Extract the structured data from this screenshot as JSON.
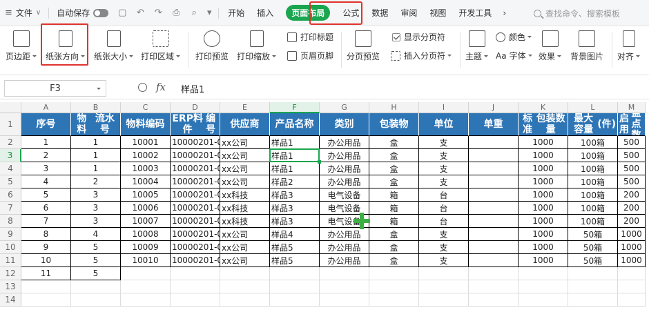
{
  "menubar": {
    "file": "文件",
    "autosave": "自动保存",
    "tabs": [
      {
        "label": "开始",
        "active": false
      },
      {
        "label": "插入",
        "active": false
      },
      {
        "label": "页面布局",
        "active": true
      },
      {
        "label": "公式",
        "active": false
      },
      {
        "label": "数据",
        "active": false
      },
      {
        "label": "审阅",
        "active": false
      },
      {
        "label": "视图",
        "active": false
      },
      {
        "label": "开发工具",
        "active": false
      }
    ],
    "more": "›",
    "search_placeholder": "查找命令、搜索模板"
  },
  "ribbon": {
    "margins": "页边距",
    "orientation": "纸张方向",
    "size": "纸张大小",
    "print_area": "打印区域",
    "print_preview": "打印预览",
    "print_scale": "打印缩放",
    "print_titles": "打印标题",
    "header_footer": "页眉页脚",
    "page_break_preview": "分页预览",
    "show_page_breaks": "显示分页符",
    "insert_page_break": "插入分页符",
    "theme": "主题",
    "colors": "颜色",
    "fonts": "字体",
    "effects": "效果",
    "background": "背景图片",
    "align": "对齐"
  },
  "formula_bar": {
    "cell_ref": "F3",
    "fx": "fx",
    "content": "样品1"
  },
  "sheet": {
    "columns": [
      "A",
      "B",
      "C",
      "D",
      "E",
      "F",
      "G",
      "H",
      "I",
      "J",
      "K",
      "L",
      "M"
    ],
    "selected_column": "F",
    "selected_row": "3",
    "headers": [
      [
        "序号"
      ],
      [
        "物料",
        "流水号"
      ],
      [
        "物料编码"
      ],
      [
        "ERP料件",
        "编号"
      ],
      [
        "供应商"
      ],
      [
        "产品名称"
      ],
      [
        "类别"
      ],
      [
        "包装物"
      ],
      [
        "单位"
      ],
      [
        "单重"
      ],
      [
        "标准",
        "包装数量"
      ],
      [
        "最大容量",
        "(件)"
      ],
      [
        "启用",
        "盘点数"
      ]
    ],
    "rows": [
      [
        "1",
        "1",
        "10001",
        "10000201-0",
        "xx公司",
        "样品1",
        "办公用品",
        "盒",
        "支",
        "",
        "1000",
        "100箱",
        "500"
      ],
      [
        "2",
        "1",
        "10002",
        "10000201-0",
        "xx公司",
        "样品1",
        "办公用品",
        "盒",
        "支",
        "",
        "1000",
        "100箱",
        "500"
      ],
      [
        "3",
        "1",
        "10003",
        "10000201-0",
        "xx公司",
        "样品1",
        "办公用品",
        "盒",
        "支",
        "",
        "1000",
        "100箱",
        "500"
      ],
      [
        "4",
        "2",
        "10004",
        "10000201-0",
        "xx公司",
        "样品2",
        "办公用品",
        "盒",
        "支",
        "",
        "1000",
        "100箱",
        "500"
      ],
      [
        "5",
        "3",
        "10005",
        "10000201-0",
        "xx科技",
        "样品3",
        "电气设备",
        "箱",
        "台",
        "",
        "1000",
        "100箱",
        "200"
      ],
      [
        "6",
        "3",
        "10006",
        "10000201-0",
        "xx科技",
        "样品3",
        "电气设备",
        "箱",
        "台",
        "",
        "1000",
        "100箱",
        "200"
      ],
      [
        "7",
        "3",
        "10007",
        "10000201-0",
        "xx科技",
        "样品3",
        "电气设备",
        "箱",
        "台",
        "",
        "1000",
        "100箱",
        "200"
      ],
      [
        "8",
        "4",
        "10008",
        "10000201-0",
        "xx公司",
        "样品4",
        "办公用品",
        "盒",
        "支",
        "",
        "1000",
        "50箱",
        "1000"
      ],
      [
        "9",
        "5",
        "10009",
        "10000201-0",
        "xx公司",
        "样品5",
        "办公用品",
        "盒",
        "支",
        "",
        "1000",
        "50箱",
        "1000"
      ],
      [
        "10",
        "5",
        "10010",
        "10000201-0",
        "xx公司",
        "样品5",
        "办公用品",
        "盒",
        "支",
        "",
        "1000",
        "50箱",
        "1000"
      ],
      [
        "11",
        "5",
        "",
        "",
        "",
        "",
        "",
        "",
        "",
        "",
        "",
        "",
        ""
      ]
    ],
    "row_numbers": [
      "1",
      "2",
      "3",
      "4",
      "5",
      "6",
      "7",
      "8",
      "9",
      "10",
      "11",
      "12",
      "13",
      "14"
    ]
  }
}
